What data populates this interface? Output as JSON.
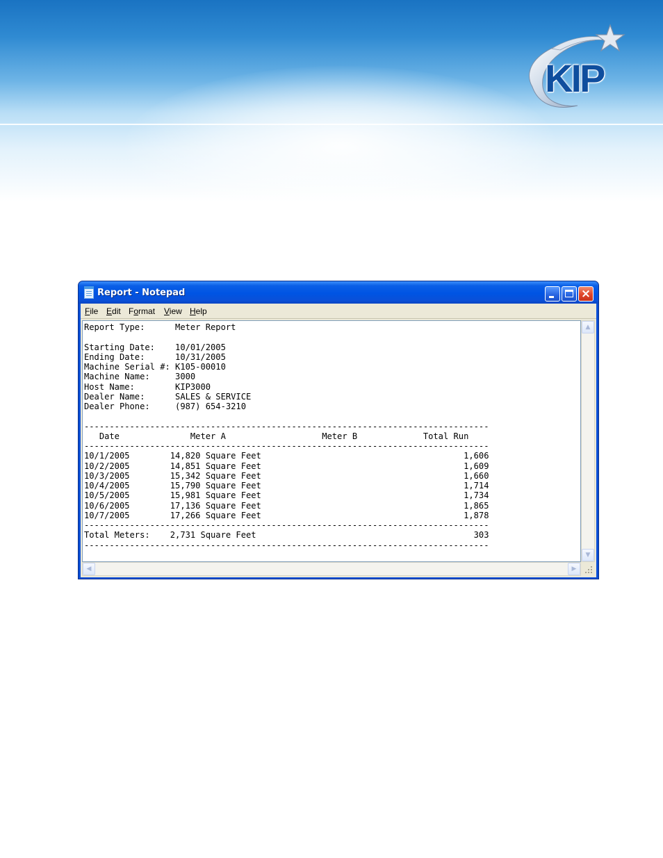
{
  "banner": {
    "logo_text": "KIP"
  },
  "window": {
    "title": "Report - Notepad",
    "menu": [
      {
        "key": "F",
        "rest": "ile"
      },
      {
        "key": "E",
        "rest": "dit"
      },
      {
        "pre": "F",
        "key": "o",
        "rest": "rmat"
      },
      {
        "key": "V",
        "rest": "iew"
      },
      {
        "key": "H",
        "rest": "elp"
      }
    ],
    "controls": {
      "minimize": "minimize",
      "maximize": "maximize",
      "close": "×"
    }
  },
  "report": {
    "lines": [
      "Report Type:      Meter Report",
      "",
      "Starting Date:    10/01/2005",
      "Ending Date:      10/31/2005",
      "Machine Serial #: K105-00010",
      "Machine Name:     3000",
      "Host Name:        KIP3000",
      "Dealer Name:      SALES & SERVICE",
      "Dealer Phone:     (987) 654-3210",
      "",
      "--------------------------------------------------------------------------------",
      "   Date              Meter A                   Meter B             Total Run",
      "--------------------------------------------------------------------------------",
      "10/1/2005        14,820 Square Feet                                        1,606",
      "10/2/2005        14,851 Square Feet                                        1,609",
      "10/3/2005        15,342 Square Feet                                        1,660",
      "10/4/2005        15,790 Square Feet                                        1,714",
      "10/5/2005        15,981 Square Feet                                        1,734",
      "10/6/2005        17,136 Square Feet                                        1,865",
      "10/7/2005        17,266 Square Feet                                        1,878",
      "--------------------------------------------------------------------------------",
      "Total Meters:    2,731 Square Feet                                           303",
      "--------------------------------------------------------------------------------"
    ]
  },
  "colors": {
    "titlebar": "#0054e3",
    "close_button": "#e0452a",
    "chrome": "#ece9d8",
    "logo": "#0f4e9e"
  }
}
